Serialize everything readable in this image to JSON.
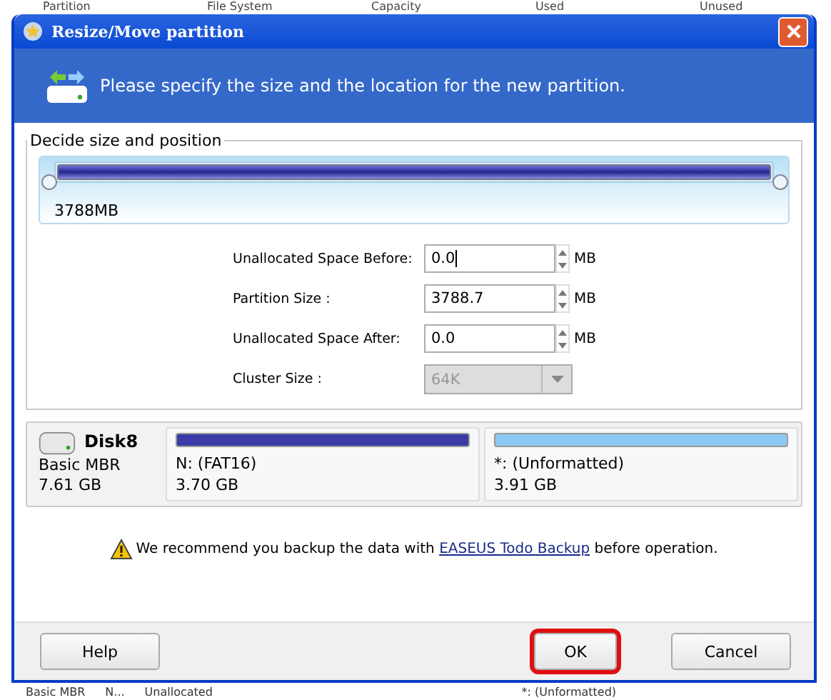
{
  "background_app": {
    "columns": [
      "Partition",
      "File System",
      "Capacity",
      "Used",
      "Unused"
    ],
    "bottom_row": [
      "Basic MBR",
      "N...",
      "Unallocated",
      "*: (Unformatted)"
    ]
  },
  "window": {
    "title": "Resize/Move partition"
  },
  "banner": {
    "text": "Please specify the size and the location for the new partition."
  },
  "size_group": {
    "title": "Decide size and position",
    "partition_label": "3788MB",
    "level": 1,
    "fields": [
      {
        "kind": "spin",
        "label": "Unallocated Space Before:",
        "value": "0.0",
        "unit": "MB",
        "disabled": false
      },
      {
        "kind": "spin",
        "label": "Partition Size :",
        "value": "3788.7",
        "unit": "MB",
        "disabled": false
      },
      {
        "kind": "spin",
        "label": "Unallocated Space After:",
        "value": "0.0",
        "unit": "MB",
        "disabled": false
      },
      {
        "kind": "dropdown",
        "label": "Cluster Size :",
        "value": "64K",
        "disabled": true
      }
    ]
  },
  "disk_map": {
    "name": "Disk8",
    "type": "Basic MBR",
    "size": "7.61 GB",
    "partitions": [
      {
        "name": "N: (FAT16)",
        "size": "3.70 GB",
        "color": "#3a3aa8"
      },
      {
        "name": "*: (Unformatted)",
        "size": "3.91 GB",
        "color": "#8cc8f4"
      }
    ]
  },
  "notice": {
    "before": "We recommend you backup the data with",
    "link": "EASEUS Todo Backup",
    "after": "before operation."
  },
  "buttons": [
    {
      "label": "Help",
      "highlighted": false
    },
    {
      "label": "OK",
      "highlighted": true
    },
    {
      "label": "Cancel",
      "highlighted": false
    }
  ]
}
